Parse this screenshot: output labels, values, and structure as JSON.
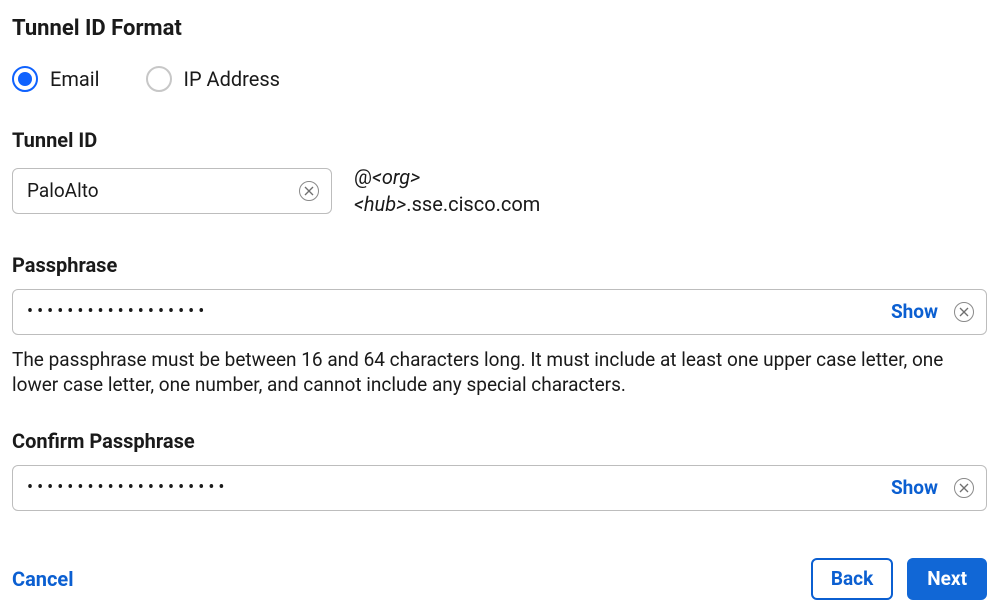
{
  "title": "Tunnel ID Format",
  "format": {
    "options": [
      {
        "label": "Email",
        "selected": true
      },
      {
        "label": "IP Address",
        "selected": false
      }
    ]
  },
  "tunnel_id": {
    "label": "Tunnel ID",
    "value": "PaloAlto",
    "suffix_at": "@",
    "suffix_org": "<org>",
    "suffix_hub": "<hub>",
    "suffix_domain": ".sse.cisco.com"
  },
  "passphrase": {
    "label": "Passphrase",
    "value": "••••••••••••••••••",
    "show_label": "Show",
    "help": "The passphrase must be between 16 and 64 characters long. It must include at least one upper case letter, one lower case letter, one number, and cannot include any special characters."
  },
  "confirm": {
    "label": "Confirm Passphrase",
    "value": "••••••••••••••••••••",
    "show_label": "Show"
  },
  "footer": {
    "cancel": "Cancel",
    "back": "Back",
    "next": "Next"
  }
}
